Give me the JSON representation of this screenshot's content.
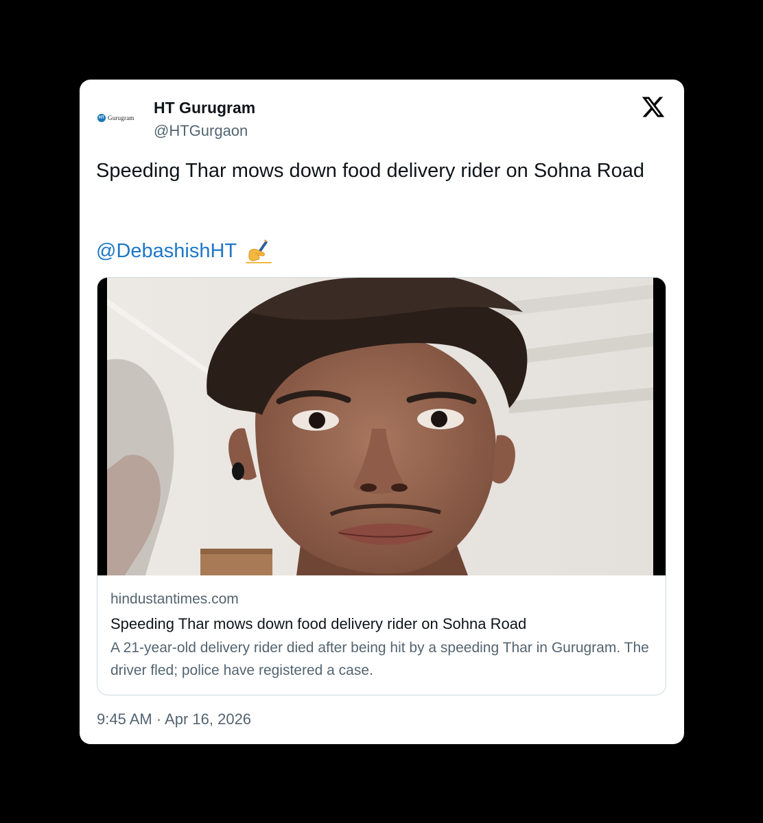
{
  "author": {
    "avatar_label": "Gurugram",
    "avatar_mark": "HT",
    "display_name": "HT Gurugram",
    "handle": "@HTGurgaon"
  },
  "platform_icon": "x-logo-icon",
  "tweet": {
    "text": "Speeding Thar mows down food delivery rider on Sohna Road",
    "mention": "@DebashishHT",
    "emoji_icon": "writing-hand-icon",
    "timestamp": "9:45 AM · Apr 16, 2026"
  },
  "link_card": {
    "image_icon": "news-photo-icon",
    "domain": "hindustantimes.com",
    "title": "Speeding Thar mows down food delivery rider on Sohna Road",
    "description": "A 21-year-old delivery rider died after being hit by a speeding Thar in Gurugram. The driver fled; police have registered a case."
  },
  "colors": {
    "background": "#000000",
    "card": "#ffffff",
    "mention": "#1d77c9",
    "secondary_text": "#536471",
    "primary_text": "#0f1419",
    "border": "#cfd9de"
  }
}
